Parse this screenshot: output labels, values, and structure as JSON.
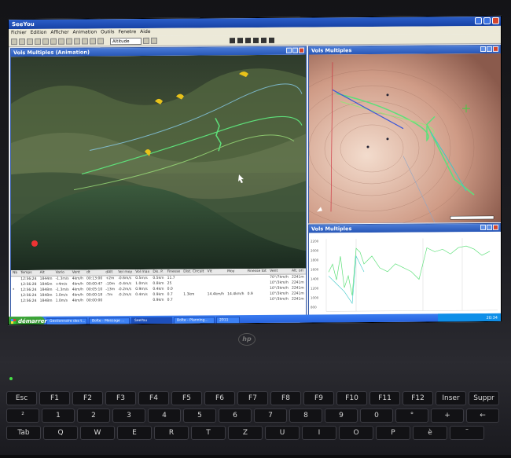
{
  "app": {
    "title": "SeeYou",
    "menu": [
      "Fichier",
      "Edition",
      "Afficher",
      "Animation",
      "Outils",
      "Fenetre",
      "Aide"
    ],
    "toolbar_select": "Altitude"
  },
  "panels": {
    "animation": {
      "title": "Vols Multiples (Animation)"
    },
    "map": {
      "title": "Vols Multiples"
    },
    "graph": {
      "title": "Vols Multiples",
      "y_ticks": [
        "2200",
        "2000",
        "1800",
        "1600",
        "1400",
        "1200",
        "1000",
        "800"
      ],
      "x_ticks": [
        "11:40:00",
        "13:20:00",
        "14:20:00",
        "14:40:00"
      ]
    }
  },
  "table": {
    "headers": [
      "Nb",
      "Temps",
      "Alt",
      "Vario",
      "Vent",
      "dt",
      "dAlt",
      "Vol moy",
      "Vol max",
      "Dis. P.",
      "Finesse",
      "Dist. Circuit",
      "Vit",
      "Moy",
      "Finesse tot",
      "Vent",
      "Alt. ori"
    ],
    "rows": [
      [
        "",
        "12:56:24",
        "1844m",
        "-1.3m/s",
        "4km/h",
        "00:13:00",
        "+2m",
        "-0.6m/s",
        "0.5m/s",
        "0.5km",
        "11.7",
        "",
        "",
        "",
        "",
        "70°/7km/h",
        "2241m"
      ],
      [
        "",
        "12:56:28",
        "1846m",
        "+4m/s",
        "4km/h",
        "00:00:47",
        "-10m",
        "-0.4m/s",
        "1.0m/s",
        "0.8km",
        "25",
        "",
        "",
        "",
        "",
        "10°/3km/h",
        "2241m"
      ],
      [
        "*",
        "12:56:24",
        "1848m",
        "-1.3m/s",
        "4km/h",
        "00:05:10",
        "-13m",
        "-0.2m/s",
        "0.9m/s",
        "0.4km",
        "0.0",
        "",
        "",
        "",
        "",
        "10°/3km/h",
        "2241m"
      ],
      [
        "",
        "12:56:24",
        "1848m",
        "1.0m/s",
        "4km/h",
        "00:00:18",
        "-7m",
        "-0.2m/s",
        "0.4m/s",
        "0.9km",
        "0.7",
        "1.3km",
        "14.4km/h",
        "14.4km/h",
        "0.9",
        "10°/3km/h",
        "2241m"
      ],
      [
        "",
        "12:56:24",
        "1848m",
        "1.0m/s",
        "4km/h",
        "00:00:00",
        "",
        "",
        "",
        "0.9km",
        "0.7",
        "",
        "",
        "",
        "",
        "10°/3km/h",
        "2241m"
      ]
    ]
  },
  "statusbar": "Pret   NUM   12:56:24",
  "taskbar": {
    "start": "démarrer",
    "tasks": [
      "Gestionnaire des t...",
      "Boîte - Message ...",
      "SeeYou",
      "Boîte - Planning...",
      "2011"
    ],
    "clock": "20:34"
  },
  "laptop": {
    "logo": "hp",
    "keys_row1": [
      "Esc",
      "F1",
      "F2",
      "F3",
      "F4",
      "F5",
      "F6",
      "F7",
      "F8",
      "F9",
      "F10",
      "F11",
      "F12",
      "Inser",
      "Suppr"
    ],
    "keys_row2": [
      "²",
      "1",
      "2",
      "3",
      "4",
      "5",
      "6",
      "7",
      "8",
      "9",
      "0",
      "°",
      "+",
      "←"
    ],
    "keys_row3": [
      "Tab",
      "Q",
      "W",
      "E",
      "R",
      "T",
      "Z",
      "U",
      "I",
      "O",
      "P",
      "è",
      "¨"
    ]
  },
  "colors": {
    "track_green": "#5ee07a",
    "track_yellow": "#e8c21a",
    "title_blue": "#2857b7",
    "start_green": "#3fa83a"
  }
}
